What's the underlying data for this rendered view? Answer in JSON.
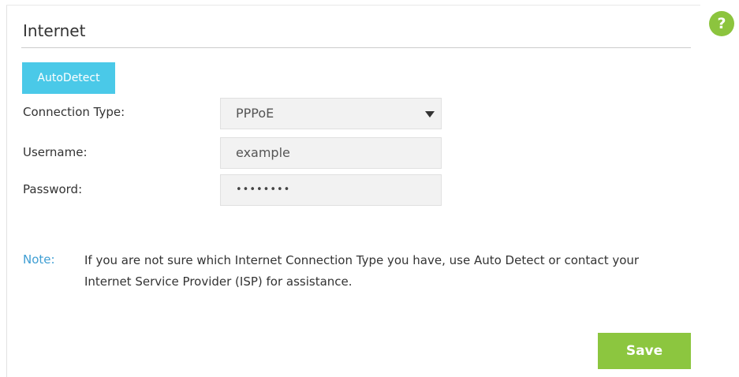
{
  "section": {
    "title": "Internet"
  },
  "help": {
    "icon": "help-question-icon",
    "glyph": "?",
    "color": "#8cc43e"
  },
  "autodetect": {
    "label": "AutoDetect",
    "color": "#4ac9e8"
  },
  "form": {
    "connection_type": {
      "label": "Connection Type:",
      "value": "PPPoE"
    },
    "username": {
      "label": "Username:",
      "value": "example"
    },
    "password": {
      "label": "Password:",
      "value": "••••••••"
    }
  },
  "note": {
    "label": "Note:",
    "text": "If you are not sure which Internet Connection Type you have, use Auto Detect or contact your Internet Service Provider (ISP) for assistance."
  },
  "save": {
    "label": "Save",
    "color": "#8cc63f"
  }
}
